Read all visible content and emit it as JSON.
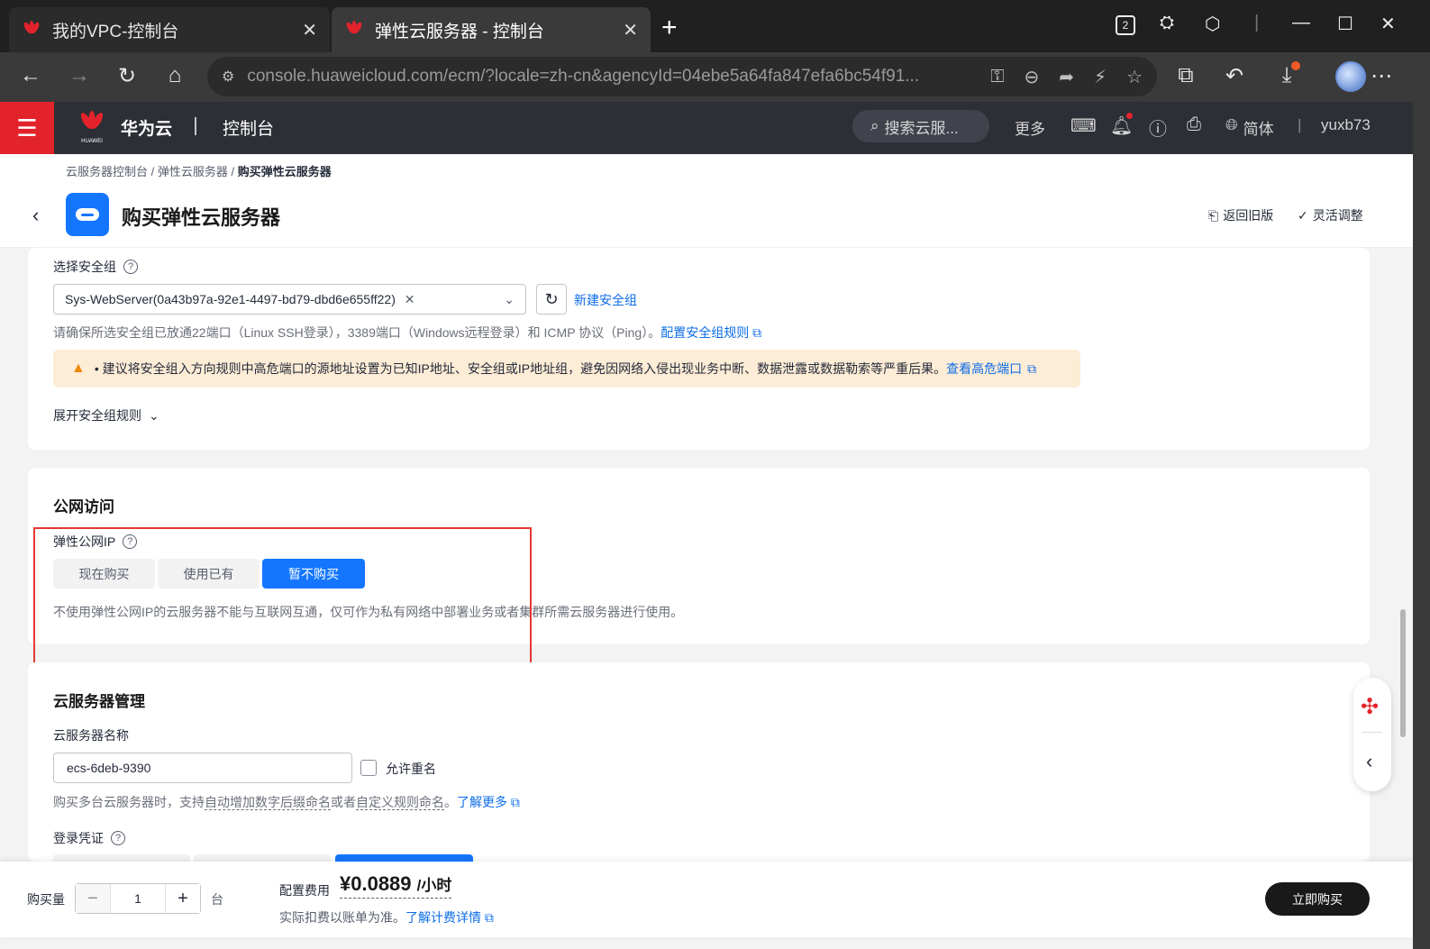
{
  "browser": {
    "tabs": [
      {
        "title": "我的VPC-控制台",
        "close": "✕"
      },
      {
        "title": "弹性云服务器 - 控制台",
        "close": "✕"
      }
    ],
    "new_tab": "+",
    "tab_count_badge": "2",
    "url": "console.huaweicloud.com/ecm/?locale=zh-cn&agencyId=04ebe5a64fa847efa6bc54f91..."
  },
  "console_header": {
    "brand": "华为云",
    "logo_text": "HUAWEI",
    "section": "控制台",
    "search_placeholder": "搜索云服...",
    "more": "更多",
    "language": "简体",
    "username": "yuxb73"
  },
  "page_header": {
    "breadcrumb": [
      "云服务器控制台",
      "弹性云服务器",
      "购买弹性云服务器"
    ],
    "separator": "/",
    "title": "购买弹性云服务器",
    "old_version": "返回旧版",
    "flexible_adjust": "灵活调整"
  },
  "security_group": {
    "label": "选择安全组",
    "selected": "Sys-WebServer(0a43b97a-92e1-4497-bd79-dbd6e655ff22)",
    "create_link": "新建安全组",
    "note": "请确保所选安全组已放通22端口（Linux SSH登录），3389端口（Windows远程登录）和 ICMP 协议（Ping）。",
    "config_link": "配置安全组规则",
    "warning": "• 建议将安全组入方向规则中高危端口的源地址设置为已知IP地址、安全组或IP地址组，避免因网络入侵出现业务中断、数据泄露或数据勒索等严重后果。",
    "warning_link": "查看高危端口",
    "expand": "展开安全组规则"
  },
  "public_access": {
    "title": "公网访问",
    "eip_label": "弹性公网IP",
    "options": [
      "现在购买",
      "使用已有",
      "暂不购买"
    ],
    "selected_index": 2,
    "note": "不使用弹性公网IP的云服务器不能与互联网互通，仅可作为私有网络中部署业务或者集群所需云服务器进行使用。"
  },
  "server_mgmt": {
    "title": "云服务器管理",
    "name_label": "云服务器名称",
    "name_value": "ecs-6deb-9390",
    "allow_dup": "允许重名",
    "hint_prefix": "购买多台云服务器时，支持",
    "hint_auto": "自动增加数字后缀命名",
    "hint_mid": "或者",
    "hint_custom": "自定义规则命名",
    "hint_end": "。",
    "learn_more": "了解更多",
    "login_label": "登录凭证"
  },
  "footer": {
    "qty_label": "购买量",
    "qty_value": "1",
    "qty_unit": "台",
    "fee_label": "配置费用",
    "price": "¥0.0889",
    "price_unit": "/小时",
    "billing_note": "实际扣费以账单为准。",
    "billing_link": "了解计费详情",
    "buy_button": "立即购买"
  },
  "colors": {
    "primary": "#1476ff",
    "header_bg": "#2d2f36",
    "menu_red": "#e3232c",
    "highlight_box": "#e53935"
  }
}
